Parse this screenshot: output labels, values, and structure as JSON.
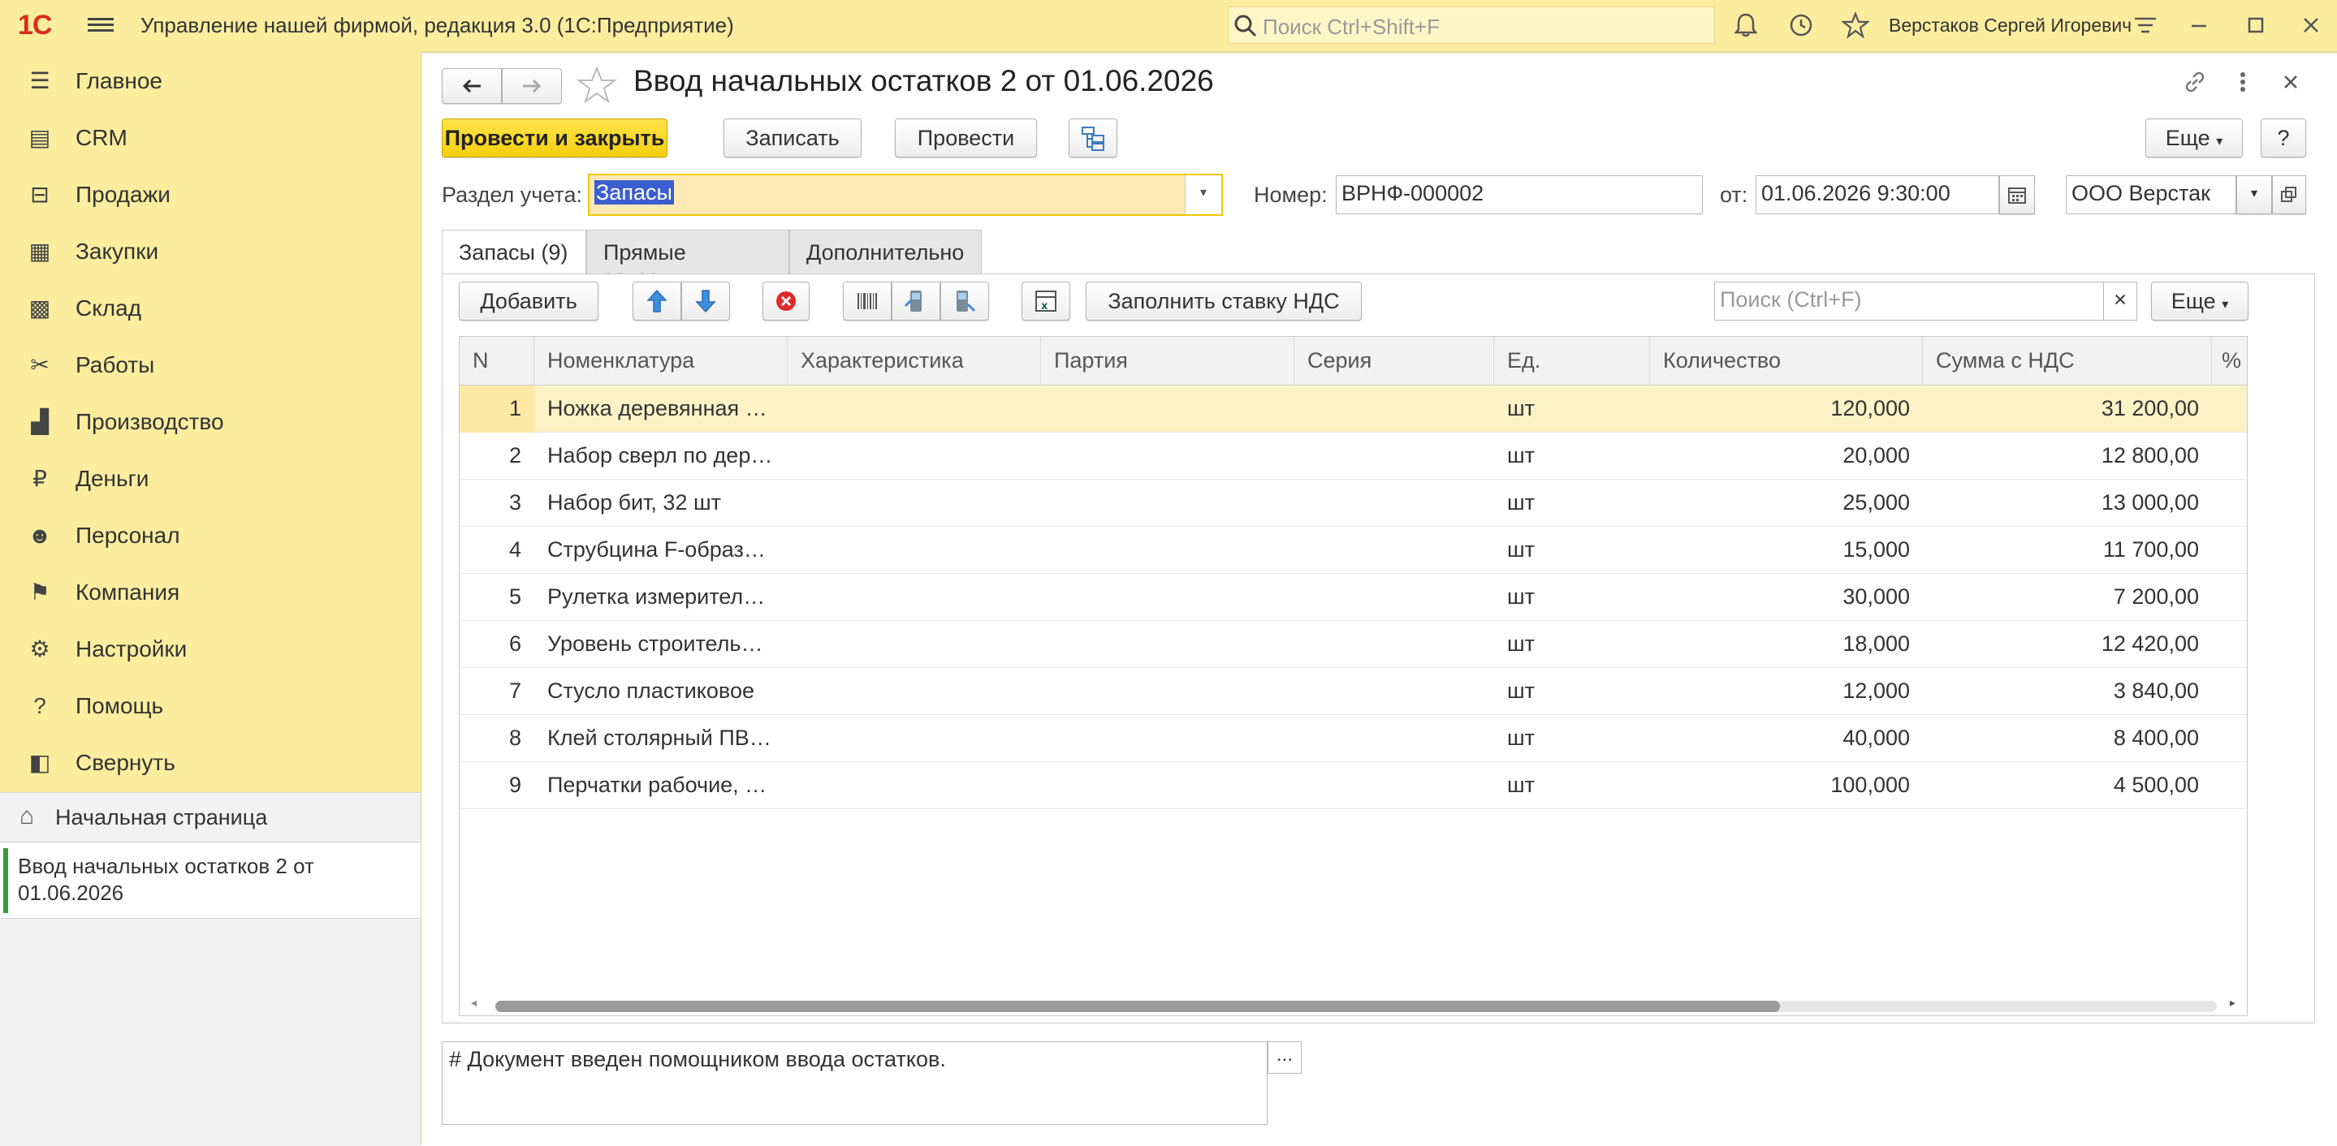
{
  "app": {
    "logo": "1С",
    "title": "Управление нашей фирмой, редакция 3.0  (1С:Предприятие)",
    "search_placeholder": "Поиск Ctrl+Shift+F",
    "user": "Верстаков Сергей Игоревич"
  },
  "sidebar": {
    "items": [
      {
        "label": "Главное",
        "icon": "menu-lines-icon"
      },
      {
        "label": "CRM",
        "icon": "crm-icon"
      },
      {
        "label": "Продажи",
        "icon": "basket-icon"
      },
      {
        "label": "Закупки",
        "icon": "cart-icon"
      },
      {
        "label": "Склад",
        "icon": "warehouse-icon"
      },
      {
        "label": "Работы",
        "icon": "tools-icon"
      },
      {
        "label": "Производство",
        "icon": "factory-icon"
      },
      {
        "label": "Деньги",
        "icon": "ruble-icon"
      },
      {
        "label": "Персонал",
        "icon": "person-icon"
      },
      {
        "label": "Компания",
        "icon": "flag-icon"
      },
      {
        "label": "Настройки",
        "icon": "gear-icon"
      },
      {
        "label": "Помощь",
        "icon": "help-icon"
      },
      {
        "label": "Свернуть",
        "icon": "collapse-icon"
      }
    ],
    "home_label": "Начальная страница",
    "open_doc_label": "Ввод начальных остатков 2 от 01.06.2026"
  },
  "document": {
    "title": "Ввод начальных остатков 2 от 01.06.2026",
    "btn_post_close": "Провести и закрыть",
    "btn_save": "Записать",
    "btn_post": "Провести",
    "btn_more": "Еще",
    "btn_help": "?",
    "section_label": "Раздел учета:",
    "section_value": "Запасы",
    "number_label": "Номер:",
    "number_value": "ВРНФ-000002",
    "date_label": "от:",
    "date_value": "01.06.2026  9:30:00",
    "org_value": "ООО Верстак"
  },
  "tabs": [
    {
      "label": "Запасы (9)"
    },
    {
      "label": "Прямые затраты"
    },
    {
      "label": "Дополнительно"
    }
  ],
  "table_toolbar": {
    "add": "Добавить",
    "fill_vat": "Заполнить ставку НДС",
    "search_placeholder": "Поиск (Ctrl+F)",
    "clear": "×",
    "more": "Еще"
  },
  "table": {
    "columns": [
      "N",
      "Номенклатура",
      "Характеристика",
      "Партия",
      "Серия",
      "Ед.",
      "Количество",
      "Сумма с НДС",
      "%"
    ],
    "rows": [
      {
        "n": "1",
        "name": "Ножка деревянная …",
        "unit": "шт",
        "qty": "120,000",
        "sum": "31 200,00"
      },
      {
        "n": "2",
        "name": "Набор сверл по дер…",
        "unit": "шт",
        "qty": "20,000",
        "sum": "12 800,00"
      },
      {
        "n": "3",
        "name": "Набор бит, 32 шт",
        "unit": "шт",
        "qty": "25,000",
        "sum": "13 000,00"
      },
      {
        "n": "4",
        "name": "Струбцина F-образ…",
        "unit": "шт",
        "qty": "15,000",
        "sum": "11 700,00"
      },
      {
        "n": "5",
        "name": "Рулетка измерител…",
        "unit": "шт",
        "qty": "30,000",
        "sum": "7 200,00"
      },
      {
        "n": "6",
        "name": "Уровень строитель…",
        "unit": "шт",
        "qty": "18,000",
        "sum": "12 420,00"
      },
      {
        "n": "7",
        "name": "Стусло пластиковое",
        "unit": "шт",
        "qty": "12,000",
        "sum": "3 840,00"
      },
      {
        "n": "8",
        "name": "Клей столярный ПВ…",
        "unit": "шт",
        "qty": "40,000",
        "sum": "8 400,00"
      },
      {
        "n": "9",
        "name": "Перчатки рабочие, …",
        "unit": "шт",
        "qty": "100,000",
        "sum": "4 500,00"
      }
    ]
  },
  "comment": {
    "text": "# Документ введен помощником ввода остатков.",
    "btn": "..."
  },
  "colors": {
    "accent_yellow": "#fbed9e",
    "primary_button": "#f5cf0c",
    "selected_row": "#fdf2c6",
    "logo_red": "#d92b1c"
  }
}
